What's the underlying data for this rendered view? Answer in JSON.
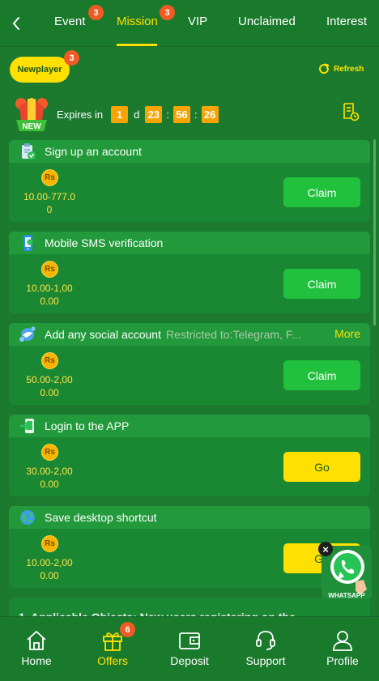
{
  "tabs": [
    {
      "label": "Event",
      "badge": "3"
    },
    {
      "label": "Mission",
      "badge": "3",
      "active": true
    },
    {
      "label": "VIP"
    },
    {
      "label": "Unclaimed"
    },
    {
      "label": "Interest"
    }
  ],
  "header": {
    "pill_label": "Newplayer",
    "pill_badge": "3",
    "refresh_label": "Refresh"
  },
  "expiry": {
    "label": "Expires in",
    "days": "1",
    "day_unit": "d",
    "hours": "23",
    "minutes": "56",
    "seconds": "26",
    "sep": ":",
    "new_tag": "NEW"
  },
  "coin_symbol": "Rs",
  "missions": [
    {
      "title": "Sign up an account",
      "range": "10.00-777.0",
      "current": "0",
      "button": "Claim",
      "icon": "clipboard-check-icon"
    },
    {
      "title": "Mobile SMS verification",
      "range": "10.00-1,00",
      "current": "0.00",
      "button": "Claim",
      "icon": "phone-icon"
    },
    {
      "title": "Add any social account",
      "restricted": "Restricted to:Telegram, F...",
      "more": "More",
      "range": "50.00-2,00",
      "current": "0.00",
      "button": "Claim",
      "icon": "social-bird-icon"
    },
    {
      "title": "Login to the APP",
      "range": "30.00-2,00",
      "current": "0.00",
      "button": "Go",
      "icon": "login-icon"
    },
    {
      "title": "Save desktop shortcut",
      "range": "10.00-2,00",
      "current": "0.00",
      "button": "Go",
      "icon": "globe-icon"
    }
  ],
  "rules_peek": "1. Applicable Objects: New users registering on the",
  "whatsapp_label": "WHATSAPP",
  "bottom_nav": [
    {
      "label": "Home"
    },
    {
      "label": "Offers",
      "badge": "6",
      "active": true
    },
    {
      "label": "Deposit"
    },
    {
      "label": "Support"
    },
    {
      "label": "Profile"
    }
  ],
  "colors": {
    "background": "#1c7a2e",
    "accent": "#ffe000",
    "claim_button": "#21c13e",
    "badge": "#ef5b24",
    "timer_box": "#f7a300"
  }
}
